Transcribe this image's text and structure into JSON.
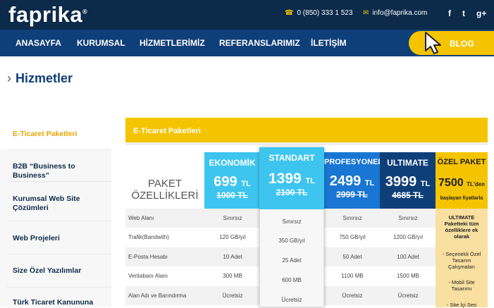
{
  "header": {
    "logo": "faprika",
    "logo_mark": "®",
    "phone": "0 (850) 333 1 523",
    "email": "info@faprika.com",
    "social": [
      "f",
      "t",
      "g+"
    ]
  },
  "nav": {
    "items": [
      "ANASAYFA",
      "KURUMSAL",
      "HİZMETLERİMİZ",
      "REFERANSLARIMIZ",
      "İLETİŞİM"
    ],
    "blog": "BLOG"
  },
  "breadcrumb": {
    "title": "Hizmetler"
  },
  "sidebar": {
    "items": [
      "E-Ticaret Paketleri",
      "B2B “Business to Business”",
      "Kurumsal Web Site Çözümleri",
      "Web Projeleri",
      "Size Özel Yazılımlar",
      "Türk Ticaret Kanununa"
    ]
  },
  "panel": {
    "title": "E-Ticaret Paketleri",
    "label_line1": "PAKET",
    "label_line2": "ÖZELLİKLERİ"
  },
  "packages": [
    {
      "name": "EKONOMİK",
      "price": "699",
      "unit": "TL",
      "old": "1000 TL",
      "color": "#3ec5ef"
    },
    {
      "name": "STANDART",
      "price": "1399",
      "unit": "TL",
      "old": "2100 TL",
      "color": "#3ec5ef"
    },
    {
      "name": "PROFESYONEL",
      "price": "2499",
      "unit": "TL",
      "old": "2999 TL",
      "color": "#1976d2"
    },
    {
      "name": "ULTIMATE",
      "price": "3999",
      "unit": "TL",
      "old": "4685 TL",
      "color": "#0f3f78"
    }
  ],
  "features": [
    {
      "label": "Web Alanı",
      "values": [
        "Sınırsız",
        "Sınırsız",
        "Sınırsız",
        "Sınırsız"
      ]
    },
    {
      "label": "Trafik(Bandwith)",
      "values": [
        "120 GB/yıl",
        "350 GB/yıl",
        "750 GB/yıl",
        "1200 GB/yıl"
      ]
    },
    {
      "label": "E-Posta Hesabı",
      "values": [
        "10 Adet",
        "25 Adet",
        "50 Adet",
        "100 Adet"
      ]
    },
    {
      "label": "Veritabanı Alanı",
      "values": [
        "300 MB",
        "600 MB",
        "1100 MB",
        "1500 MB"
      ]
    },
    {
      "label": "Alan Adı ve Barındırma",
      "values": [
        "Ücretsiz",
        "Ücretsiz",
        "Ücretsiz",
        "Ücretsiz"
      ]
    }
  ],
  "ozel": {
    "name": "ÖZEL PAKET",
    "price": "7500",
    "unit": "TL'den",
    "sub": "başlayan fiyatlarla",
    "desc1": "ULTIMATE Paketteki tüm özelliklere ek olarak",
    "desc2": "- Seçenekli Özel Tasarım Çalışmaları",
    "desc3": "- Mobil Site Tasarımı",
    "desc4": "- Site İçi Seo"
  }
}
